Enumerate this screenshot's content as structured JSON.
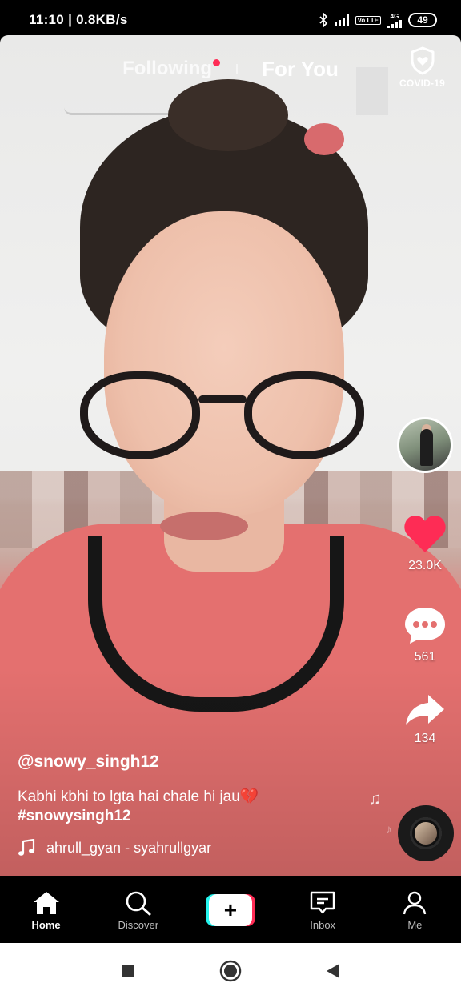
{
  "status_bar": {
    "time_speed": "11:10 | 0.8KB/s",
    "network": "4G",
    "volte": "Vo LTE",
    "battery": "49"
  },
  "top_tabs": {
    "following": "Following",
    "for_you": "For You",
    "covid_label": "COVID-19"
  },
  "actions": {
    "likes": "23.0K",
    "comments": "561",
    "shares": "134"
  },
  "post": {
    "username": "@snowy_singh12",
    "description": "Kabhi kbhi to lgta hai chale hi jau💔",
    "hashtag": "#snowysingh12",
    "music": "ahrull_gyan - syahrullgyar"
  },
  "bottom_nav": {
    "home": "Home",
    "discover": "Discover",
    "inbox": "Inbox",
    "me": "Me"
  },
  "colors": {
    "like_red": "#fe2c55",
    "add_cyan": "#25f4ee",
    "add_pink": "#fe2c55"
  }
}
